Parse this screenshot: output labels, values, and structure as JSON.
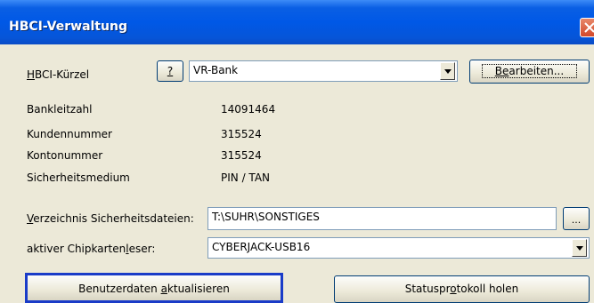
{
  "window": {
    "title": "HBCI-Verwaltung"
  },
  "kuerzel": {
    "label_u": "H",
    "label_rest": "BCI-Kürzel",
    "help_label": "?",
    "value": "VR-Bank",
    "edit_pre": "B",
    "edit_u": "e",
    "edit_post": "arbeiten..."
  },
  "info": [
    {
      "label": "Bankleitzahl",
      "value": "14091464"
    },
    {
      "label": "Kundennummer",
      "value": "315524"
    },
    {
      "label": "Kontonummer",
      "value": "315524"
    },
    {
      "label": "Sicherheitsmedium",
      "value": "PIN / TAN"
    }
  ],
  "verzeichnis": {
    "label_u": "V",
    "label_rest": "erzeichnis Sicherheitsdateien:",
    "value": "T:\\SUHR\\SONSTIGES",
    "browse_label": "..."
  },
  "chip": {
    "label_pre": "aktiver Chipkarten",
    "label_u": "l",
    "label_post": "eser:",
    "value": "CYBERJACK-USB16"
  },
  "buttons": {
    "update_pre": "Benutzerdaten ",
    "update_u": "a",
    "update_post": "ktualisieren",
    "status_pre": "Statuspr",
    "status_u": "o",
    "status_post": "tokoll holen"
  }
}
